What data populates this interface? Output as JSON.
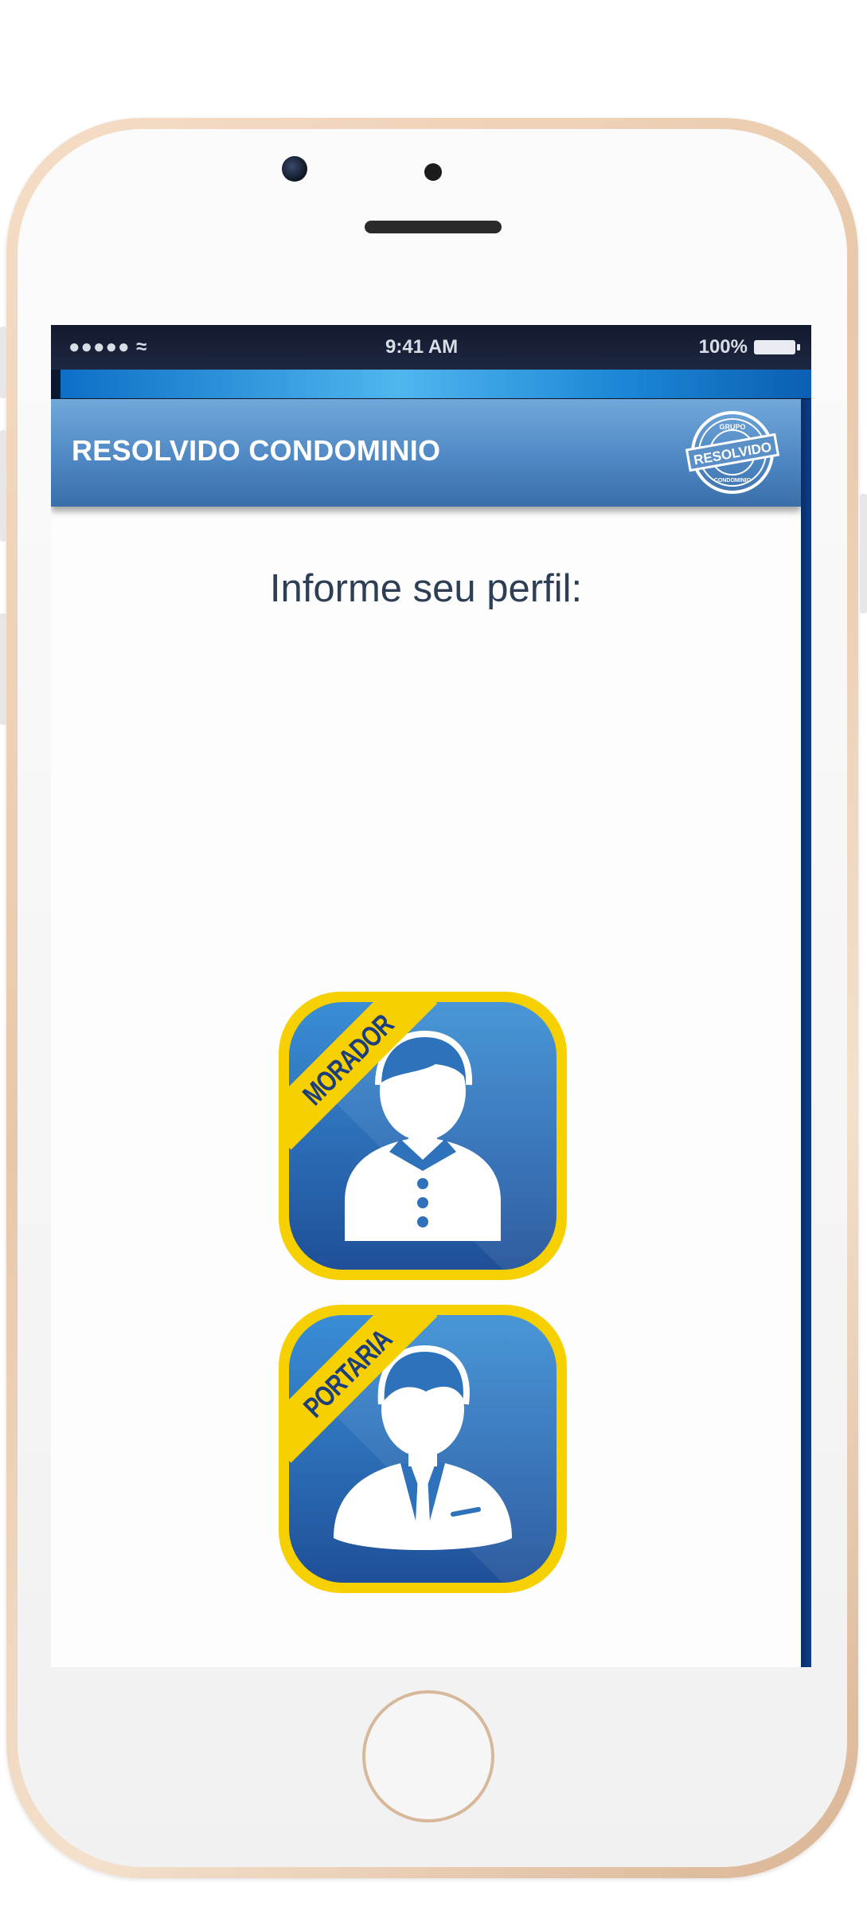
{
  "status_bar": {
    "signal": "●●●●● ≈",
    "time": "9:41 AM",
    "battery": "100%"
  },
  "app_bar": {
    "title": "RESOLVIDO CONDOMINIO",
    "logo_text_top": "GRUPO",
    "logo_text_main": "RESOLVIDO",
    "logo_text_bottom": "CONDOMINIO"
  },
  "main": {
    "prompt": "Informe seu perfil:",
    "profiles": [
      {
        "label": "MORADOR",
        "icon": "resident-icon"
      },
      {
        "label": "PORTARIA",
        "icon": "doorman-icon"
      }
    ]
  },
  "colors": {
    "app_bar": "#4f88c4",
    "button_border": "#f6d000",
    "button_fill": "#2d72bb",
    "prompt_text": "#2d3e55"
  }
}
